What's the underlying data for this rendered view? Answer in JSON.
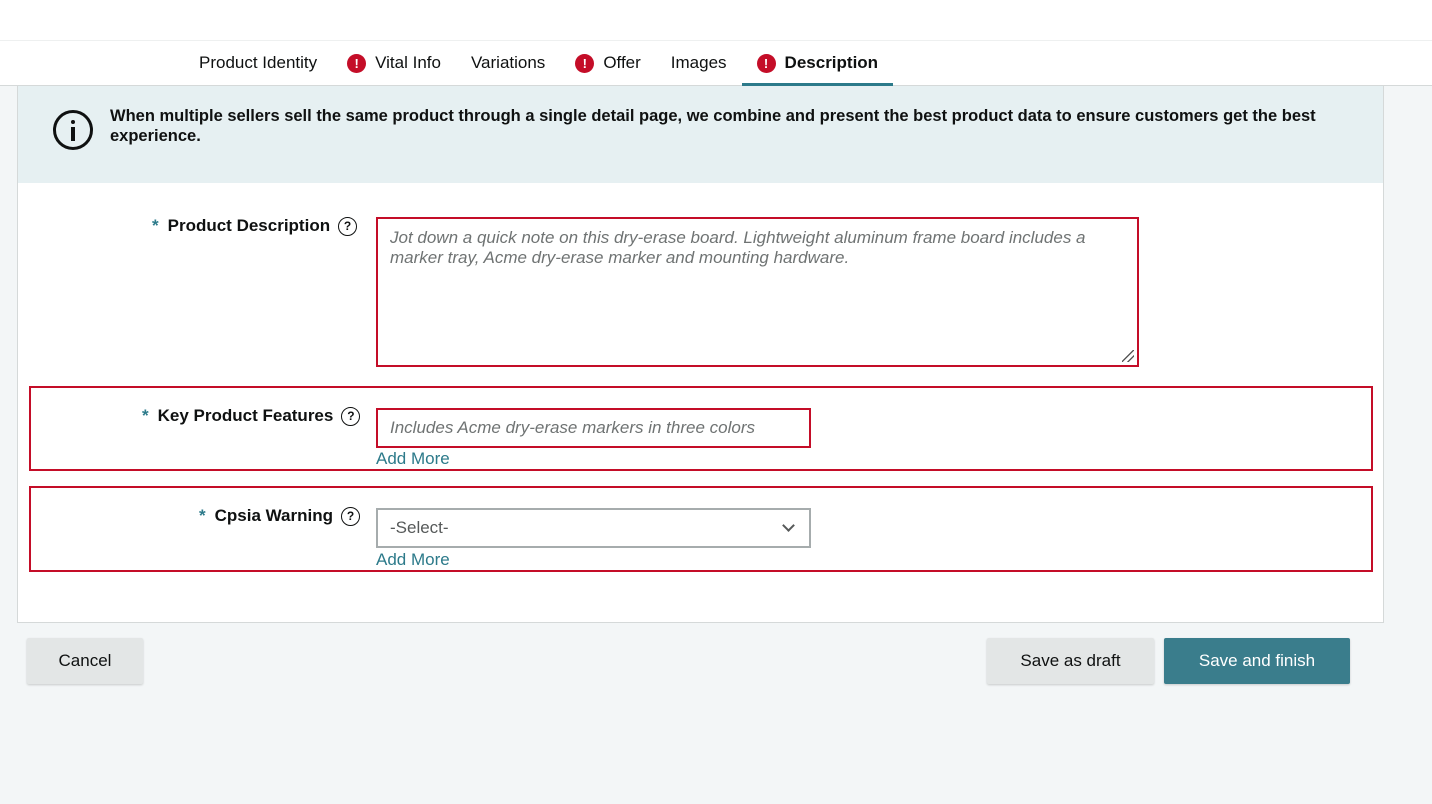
{
  "tabs": [
    {
      "label": "Product Identity",
      "error": false,
      "active": false
    },
    {
      "label": "Vital Info",
      "error": true,
      "active": false
    },
    {
      "label": "Variations",
      "error": false,
      "active": false
    },
    {
      "label": "Offer",
      "error": true,
      "active": false
    },
    {
      "label": "Images",
      "error": false,
      "active": false
    },
    {
      "label": "Description",
      "error": true,
      "active": true
    }
  ],
  "banner": {
    "text": "When multiple sellers sell the same product through a single detail page, we combine and present the best product data to ensure customers get the best experience."
  },
  "fields": {
    "required_mark": "*",
    "help_glyph": "?",
    "error_glyph": "!",
    "product_description": {
      "label": "Product Description",
      "placeholder": "Jot down a quick note on this dry-erase board. Lightweight aluminum frame board includes a marker tray, Acme dry-erase marker and mounting hardware."
    },
    "key_features": {
      "label": "Key Product Features",
      "placeholder": "Includes Acme dry-erase markers in three colors",
      "add_more": "Add More"
    },
    "cpsia_warning": {
      "label": "Cpsia Warning",
      "selected": "-Select-",
      "add_more": "Add More"
    }
  },
  "buttons": {
    "cancel": "Cancel",
    "save_draft": "Save as draft",
    "save_finish": "Save and finish"
  },
  "colors": {
    "accent": "#2c7a8a",
    "error": "#c40d28",
    "primary_button": "#3a7d8c",
    "banner_bg": "#e6f0f2"
  }
}
